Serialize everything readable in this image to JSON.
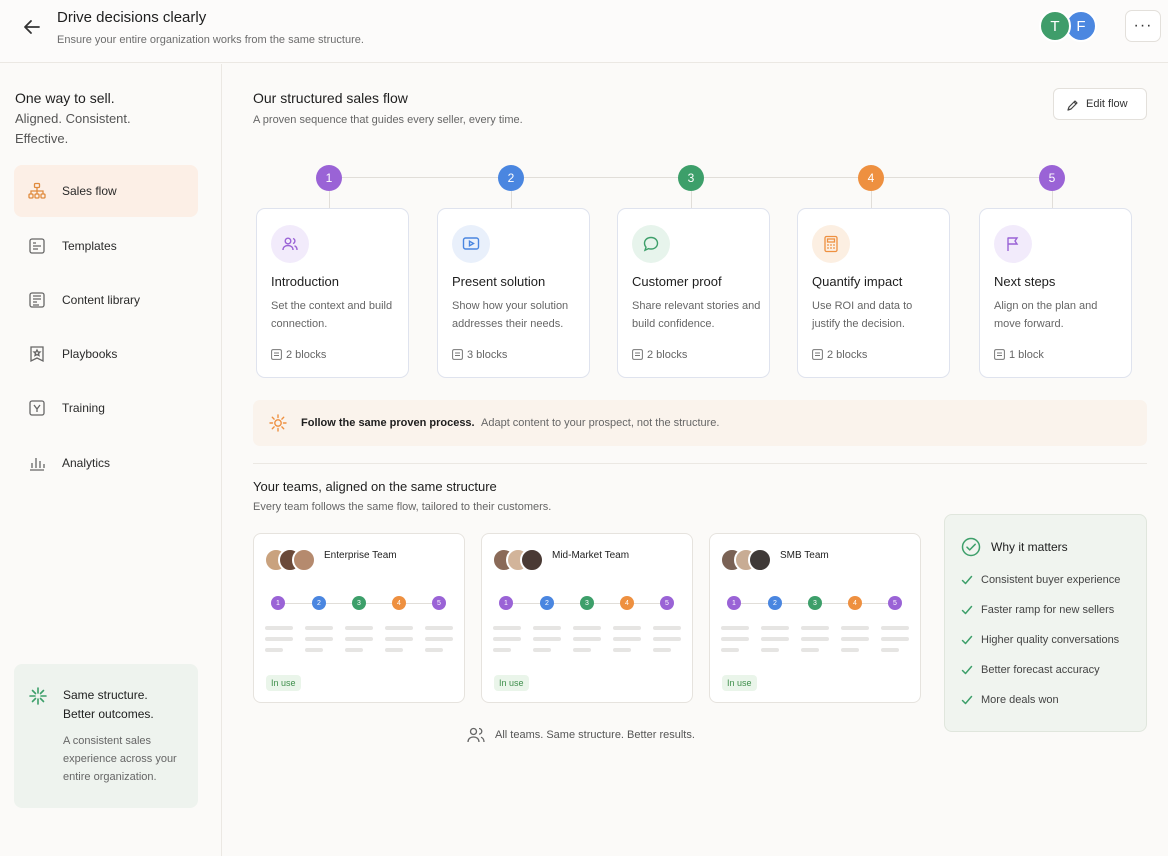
{
  "header": {
    "title": "Drive decisions clearly",
    "subtitle": "Ensure your entire organization works from the same structure.",
    "avatars": [
      "T",
      "F"
    ],
    "more": "···"
  },
  "sidebar": {
    "title": "One way to sell.",
    "tagline_1": "Aligned. Consistent.",
    "tagline_2": "Effective.",
    "items": [
      {
        "label": "Sales flow",
        "icon": "flow-icon",
        "active": true
      },
      {
        "label": "Templates",
        "icon": "template-icon",
        "active": false
      },
      {
        "label": "Content library",
        "icon": "library-icon",
        "active": false
      },
      {
        "label": "Playbooks",
        "icon": "playbook-icon",
        "active": false
      },
      {
        "label": "Training",
        "icon": "training-icon",
        "active": false
      },
      {
        "label": "Analytics",
        "icon": "analytics-icon",
        "active": false
      }
    ],
    "card": {
      "title_1": "Same structure.",
      "title_2": "Better outcomes.",
      "desc": "A consistent sales experience across your entire organization."
    }
  },
  "flow": {
    "title": "Our structured sales flow",
    "subtitle": "A proven sequence that guides every seller, every time.",
    "edit_label": "Edit flow",
    "steps": [
      {
        "num": "1",
        "name": "Introduction",
        "desc": "Set the context and build connection.",
        "blocks": "2 blocks",
        "color": "#9a63d6",
        "tint": "#f2ebfb",
        "icon": "users-icon"
      },
      {
        "num": "2",
        "name": "Present solution",
        "desc": "Show how your solution addresses their needs.",
        "blocks": "3 blocks",
        "color": "#4a86e0",
        "tint": "#e9f0fb",
        "icon": "play-icon"
      },
      {
        "num": "3",
        "name": "Customer proof",
        "desc": "Share relevant stories and build confidence.",
        "blocks": "2 blocks",
        "color": "#3d9f6a",
        "tint": "#e7f4ec",
        "icon": "chat-icon"
      },
      {
        "num": "4",
        "name": "Quantify impact",
        "desc": "Use ROI and data to justify the decision.",
        "blocks": "2 blocks",
        "color": "#ee9040",
        "tint": "#fcefe2",
        "icon": "calculator-icon"
      },
      {
        "num": "5",
        "name": "Next steps",
        "desc": "Align on the plan and move forward.",
        "blocks": "1 block",
        "color": "#9a63d6",
        "tint": "#f2ebfb",
        "icon": "flag-icon"
      }
    ]
  },
  "banner": {
    "bold": "Follow the same proven process.",
    "rest": "Adapt content to your prospect, not the structure."
  },
  "teams": {
    "title": "Your teams, aligned on the same structure",
    "subtitle": "Every team follows the same flow, tailored to their customers.",
    "items": [
      {
        "name": "Enterprise Team",
        "status": "In use"
      },
      {
        "name": "Mid-Market Team",
        "status": "In use"
      },
      {
        "name": "SMB Team",
        "status": "In use"
      }
    ],
    "dots": [
      "1",
      "2",
      "3",
      "4",
      "5"
    ],
    "footer": "All teams. Same structure. Better results."
  },
  "why": {
    "title": "Why it matters",
    "items": [
      "Consistent buyer experience",
      "Faster ramp for new sellers",
      "Higher quality conversations",
      "Better forecast accuracy",
      "More deals won"
    ]
  }
}
